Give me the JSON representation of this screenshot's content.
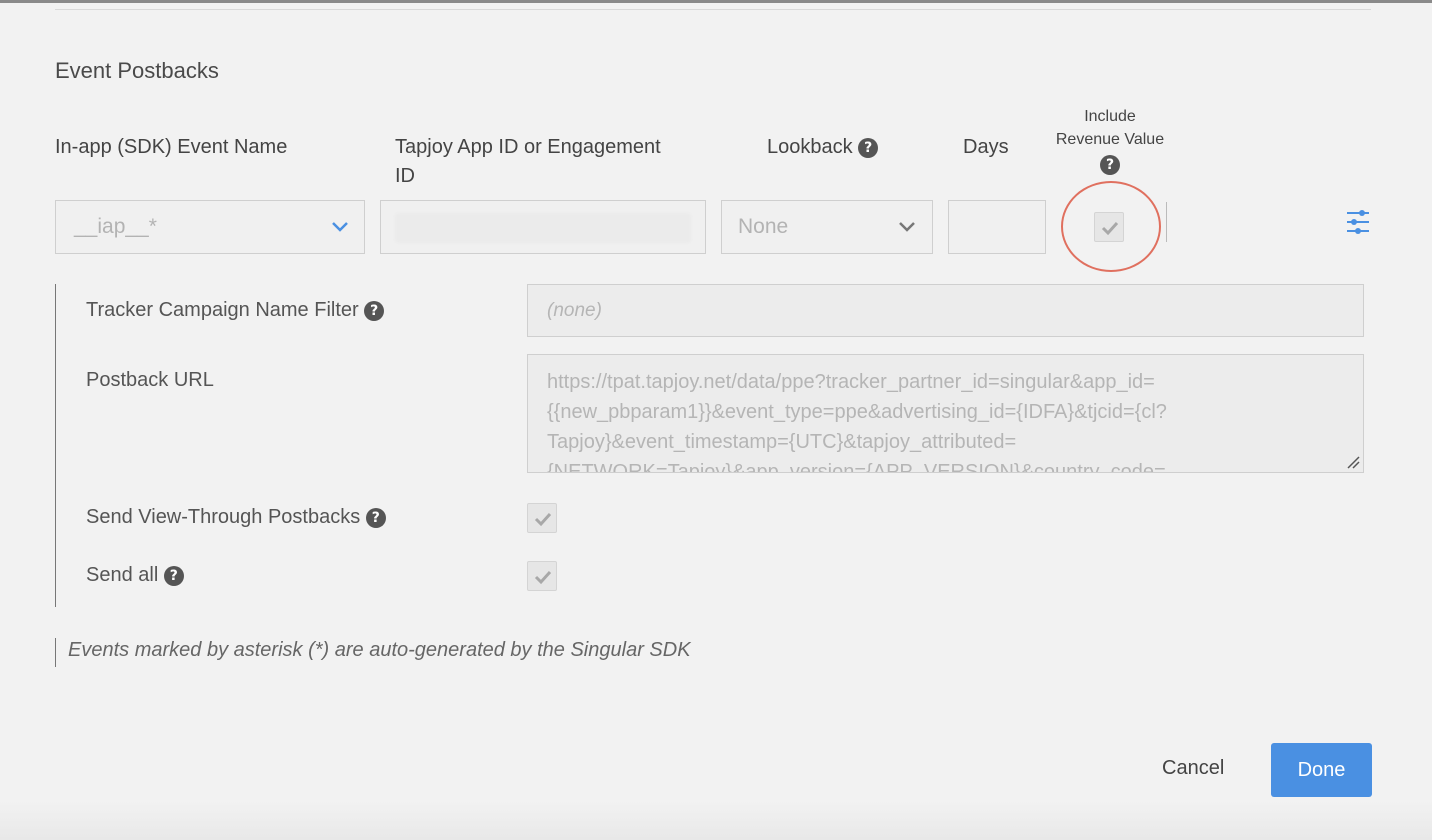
{
  "section_title": "Event Postbacks",
  "columns": {
    "event_name": "In-app (SDK) Event Name",
    "app_id_line1": "Tapjoy App ID or Engagement",
    "app_id_line2": "ID",
    "lookback": "Lookback",
    "days": "Days",
    "revenue_line1": "Include",
    "revenue_line2": "Revenue Value"
  },
  "row": {
    "event_select_value": "__iap__*",
    "lookback_value": "None",
    "days_value": "",
    "include_revenue_checked": true
  },
  "settings": {
    "campaign_filter_label": "Tracker Campaign Name Filter",
    "campaign_filter_placeholder": "(none)",
    "postback_url_label": "Postback URL",
    "postback_url_value": "https://tpat.tapjoy.net/data/ppe?tracker_partner_id=singular&app_id=\n{{new_pbparam1}}&event_type=ppe&advertising_id={IDFA}&tjcid={cl?\nTapjoy}&event_timestamp={UTC}&tapjoy_attributed=\n{NETWORK=Tapjoy}&app_version={APP_VERSION}&country_code=",
    "view_through_label": "Send View-Through Postbacks",
    "view_through_checked": true,
    "send_all_label": "Send all",
    "send_all_checked": true
  },
  "footnote": "Events marked by asterisk (*) are auto-generated by the Singular SDK",
  "buttons": {
    "cancel": "Cancel",
    "done": "Done"
  },
  "help_glyph": "?",
  "colors": {
    "accent": "#4a90e2",
    "highlight_circle": "#e0705f",
    "background": "#f2f2f2"
  },
  "icons": [
    "help-icon",
    "chevron-down-icon",
    "checkmark-icon",
    "sliders-icon"
  ]
}
